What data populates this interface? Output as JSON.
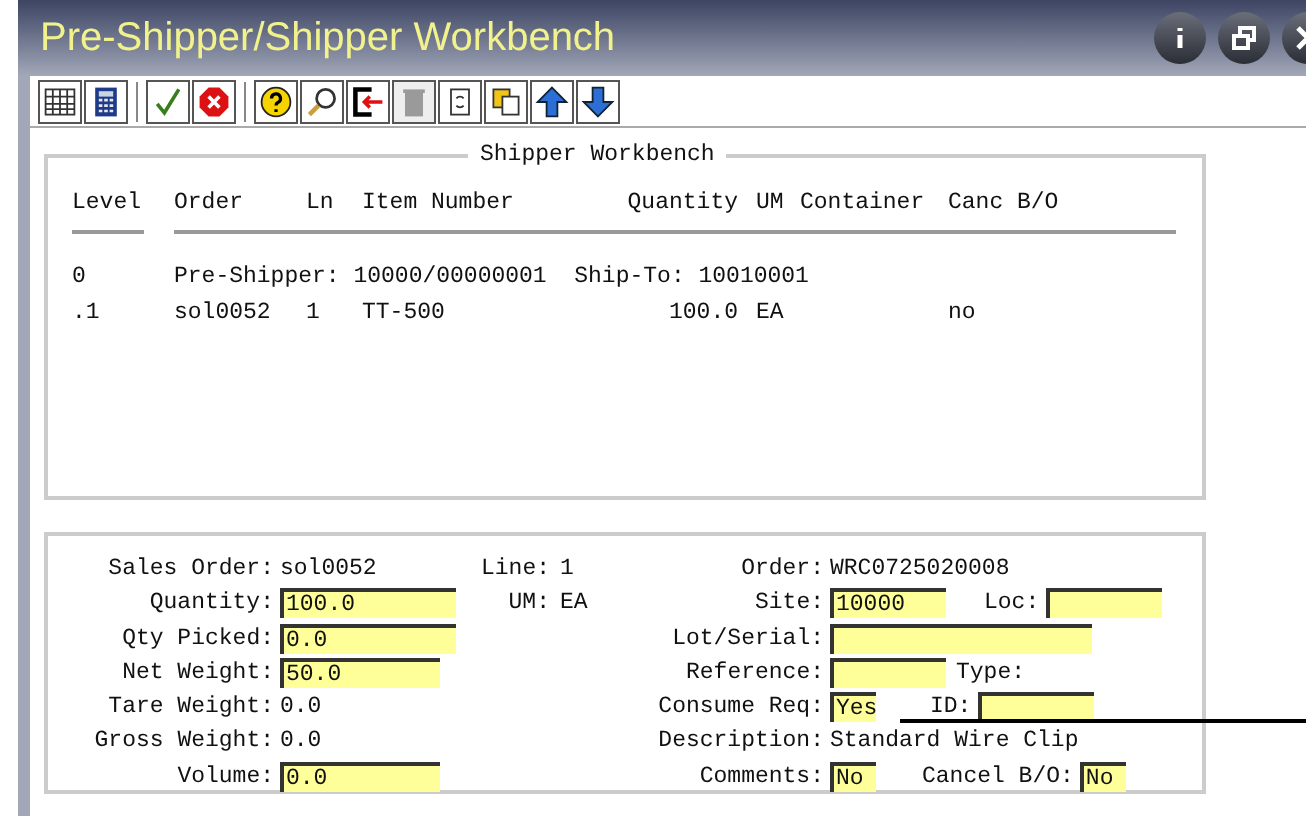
{
  "window": {
    "title": "Pre-Shipper/Shipper Workbench"
  },
  "toolbar": [
    {
      "kind": "grid",
      "disabled": false
    },
    {
      "kind": "calculator",
      "disabled": false
    },
    {
      "kind": "check",
      "disabled": false
    },
    {
      "kind": "cancel",
      "disabled": false
    },
    {
      "kind": "help",
      "disabled": false
    },
    {
      "kind": "search",
      "disabled": false
    },
    {
      "kind": "exit",
      "disabled": false
    },
    {
      "kind": "trash",
      "disabled": true
    },
    {
      "kind": "refresh",
      "disabled": false
    },
    {
      "kind": "copy",
      "disabled": false
    },
    {
      "kind": "up",
      "disabled": false
    },
    {
      "kind": "down",
      "disabled": false
    }
  ],
  "workbench": {
    "title": "Shipper Workbench",
    "columns": [
      "Level",
      "Order",
      "Ln",
      "Item Number",
      "Quantity",
      "UM",
      "Container",
      "Canc B/O"
    ],
    "rows": [
      {
        "kind": "header",
        "level": "0",
        "text": "Pre-Shipper: 10000/00000001  Ship-To: 10010001"
      },
      {
        "kind": "line",
        "cells": [
          "sol0052",
          "1",
          "TT-500",
          "100.0",
          "EA",
          "",
          "no"
        ],
        "level": ".1"
      }
    ]
  },
  "detail": [
    {
      "left": {
        "label": "Sales Order:",
        "value": "sol0052",
        "kind": "text"
      },
      "middle": {
        "label": "Line:",
        "value": "1"
      },
      "right": [
        {
          "label": "Order:",
          "value": "WRC0725020008",
          "kind": "text"
        }
      ]
    },
    {
      "left": {
        "label": "Quantity:",
        "value": "100.0",
        "kind": "input"
      },
      "middle": {
        "label": "UM:",
        "value": "EA"
      },
      "right": [
        {
          "label": "Site:",
          "value": "10000",
          "kind": "input"
        },
        {
          "label": "Loc:",
          "kind": "input"
        }
      ]
    },
    {
      "left": {
        "label": "Qty Picked:",
        "value": "0.0",
        "kind": "input"
      },
      "right": [
        {
          "label": "Lot/Serial:",
          "kind": "input"
        }
      ]
    },
    {
      "left": {
        "label": "Net Weight:",
        "value": "50.0",
        "kind": "input"
      },
      "right": [
        {
          "label": "Reference:",
          "kind": "input"
        },
        {
          "label": "Type:",
          "kind": "label"
        }
      ]
    },
    {
      "left": {
        "label": "Tare Weight:",
        "value": "0.0",
        "kind": "text"
      },
      "right": [
        {
          "label": "Consume Req:",
          "value": "Yes",
          "kind": "input"
        },
        {
          "label": "ID:",
          "kind": "input"
        }
      ]
    },
    {
      "left": {
        "label": "Gross Weight:",
        "value": "0.0",
        "kind": "text"
      },
      "right": [
        {
          "label": "Description:",
          "value": "Standard Wire Clip",
          "kind": "text"
        }
      ]
    },
    {
      "left": {
        "label": "Volume:",
        "value": "0.0",
        "kind": "input"
      },
      "right": [
        {
          "label": "Comments:",
          "value": "No",
          "kind": "input"
        },
        {
          "label": "Cancel B/O:",
          "value": "No",
          "kind": "input"
        }
      ]
    }
  ]
}
